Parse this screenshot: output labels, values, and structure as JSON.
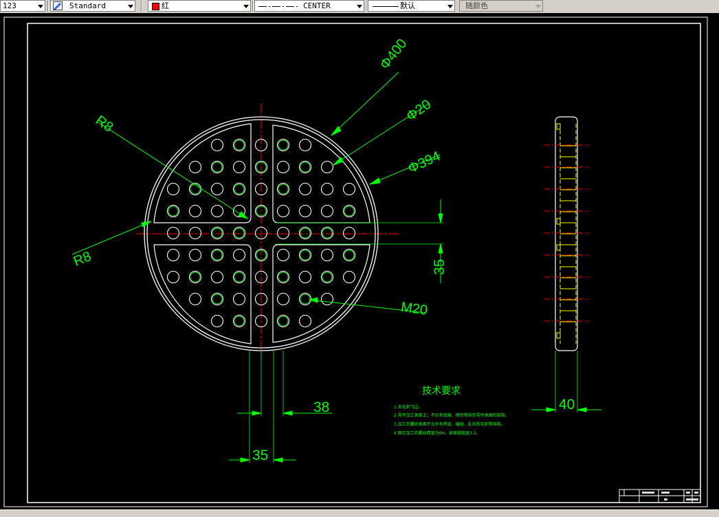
{
  "toolbar": {
    "text_height": {
      "value": "123"
    },
    "text_style": {
      "value": "Standard",
      "icon": "text-style-icon"
    },
    "color": {
      "value": "红",
      "swatch": "#ff0000"
    },
    "linetype": {
      "value": "CENTER"
    },
    "lineweight": {
      "value": "默认"
    },
    "plot_style": {
      "value": "随颜色"
    }
  },
  "drawing": {
    "dimensions": {
      "outer_diameter": "Φ400",
      "hole_diameter": "Φ20",
      "inner_diameter": "Φ394",
      "radius_top": "R8",
      "radius_left": "R8",
      "gap_vertical": "35",
      "gap_horizontal": "35",
      "offset_38": "38",
      "thread": "M20",
      "thickness": "40"
    },
    "tech_requirements": {
      "title": "技术要求",
      "items": [
        "1.去毛刺飞边。",
        "2.零件加工表面上，不应有划痕、擦伤等损伤零件表面的缺陷。",
        "3.加工的螺纹表面不允许有黑皮、磕碰、乱扣和毛刺等缺陷。",
        "4.图示加工的螺纹精度为6H，表面粗糙度3.2。"
      ]
    },
    "colors": {
      "outline": "#ffffff",
      "dimension": "#00ff00",
      "center": "#ff0000",
      "hidden": "#ffff00",
      "background": "#000000"
    }
  }
}
